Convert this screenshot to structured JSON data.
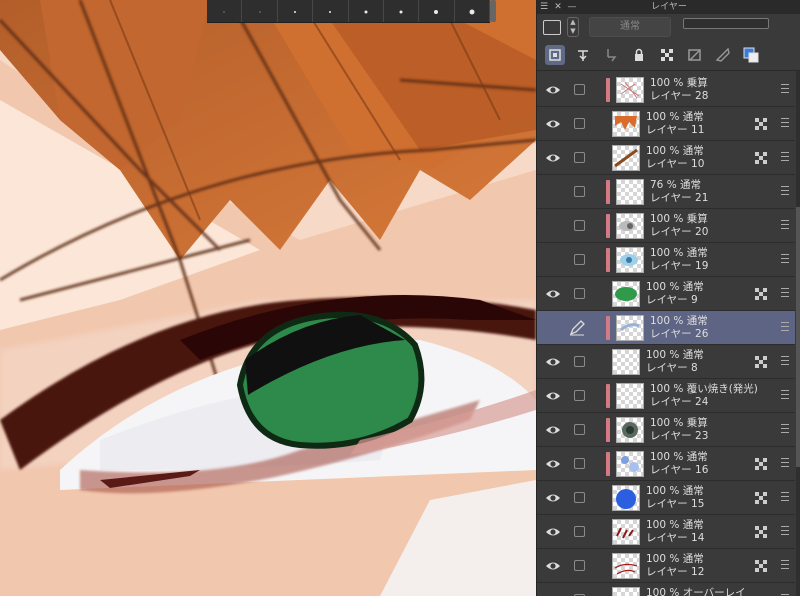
{
  "panel": {
    "title": "レイヤー",
    "blend_mode": "通常",
    "toolbar_icons": [
      "new-layer-icon",
      "clip-icon",
      "reference-icon",
      "lock-icon",
      "lock-transparent-icon",
      "mask-icon",
      "ruler-icon",
      "color-icon"
    ]
  },
  "brush_strip": {
    "dot_sizes": [
      1,
      1,
      2,
      2,
      3,
      3,
      4,
      5
    ]
  },
  "layers": [
    {
      "opacity": "100 %",
      "blend": "乗算",
      "name": "レイヤー 28",
      "clip": true,
      "visible": true,
      "thumb": "sketch"
    },
    {
      "opacity": "100 %",
      "blend": "通常",
      "name": "レイヤー 11",
      "clip": false,
      "visible": true,
      "thumb": "hair",
      "locked": true
    },
    {
      "opacity": "100 %",
      "blend": "通常",
      "name": "レイヤー 10",
      "clip": false,
      "visible": true,
      "thumb": "stroke",
      "locked": true
    },
    {
      "opacity": "76 %",
      "blend": "通常",
      "name": "レイヤー 21",
      "clip": true,
      "visible": false,
      "thumb": "empty"
    },
    {
      "opacity": "100 %",
      "blend": "乗算",
      "name": "レイヤー 20",
      "clip": true,
      "visible": false,
      "thumb": "grey"
    },
    {
      "opacity": "100 %",
      "blend": "通常",
      "name": "レイヤー 19",
      "clip": true,
      "visible": false,
      "thumb": "blue"
    },
    {
      "opacity": "100 %",
      "blend": "通常",
      "name": "レイヤー 9",
      "clip": false,
      "visible": true,
      "thumb": "green",
      "locked": true
    },
    {
      "opacity": "100 %",
      "blend": "通常",
      "name": "レイヤー 26",
      "clip": true,
      "visible": false,
      "thumb": "lightblue",
      "selected": true
    },
    {
      "opacity": "100 %",
      "blend": "通常",
      "name": "レイヤー 8",
      "clip": false,
      "visible": true,
      "thumb": "empty",
      "locked": true
    },
    {
      "opacity": "100 %",
      "blend": "覆い焼き(発光)",
      "name": "レイヤー 24",
      "clip": true,
      "visible": true,
      "thumb": "empty"
    },
    {
      "opacity": "100 %",
      "blend": "乗算",
      "name": "レイヤー 23",
      "clip": true,
      "visible": true,
      "thumb": "dark"
    },
    {
      "opacity": "100 %",
      "blend": "通常",
      "name": "レイヤー 16",
      "clip": true,
      "visible": true,
      "thumb": "bluedots",
      "locked": true
    },
    {
      "opacity": "100 %",
      "blend": "通常",
      "name": "レイヤー 15",
      "clip": false,
      "visible": true,
      "thumb": "bluecircle",
      "locked": true
    },
    {
      "opacity": "100 %",
      "blend": "通常",
      "name": "レイヤー 14",
      "clip": false,
      "visible": true,
      "thumb": "redmarks",
      "locked": true
    },
    {
      "opacity": "100 %",
      "blend": "通常",
      "name": "レイヤー 12",
      "clip": false,
      "visible": true,
      "thumb": "redlines",
      "locked": true
    },
    {
      "opacity": "100 %",
      "blend": "オーバーレイ",
      "name": "",
      "clip": false,
      "visible": true,
      "thumb": "empty"
    }
  ]
}
